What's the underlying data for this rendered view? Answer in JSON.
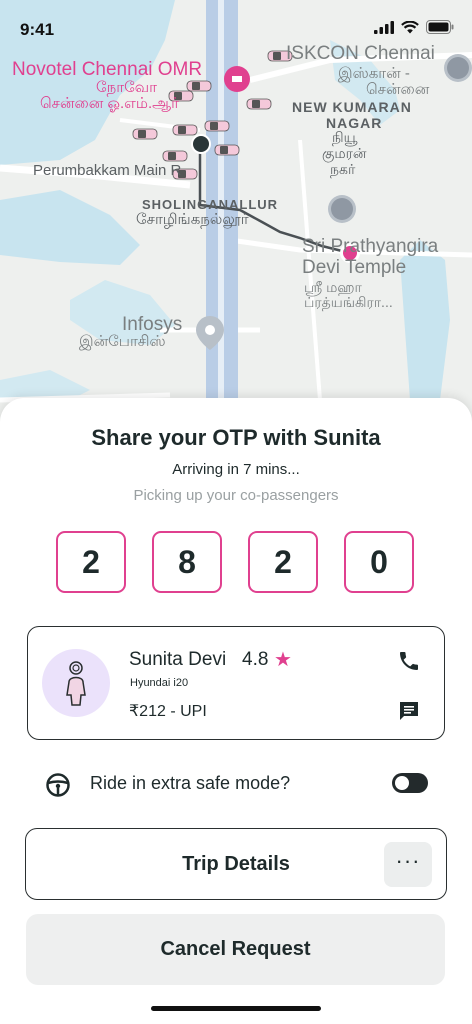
{
  "status_bar": {
    "time": "9:41"
  },
  "map": {
    "labels": {
      "novotel": "Novotel Chennai OMR",
      "novotel_tamil_1": "நோவோ",
      "novotel_tamil_2": "சென்னை ஓ.எம்.ஆர்",
      "iskcon": "ISKCON Chennai",
      "iskcon_tamil_1": "இஸ்கான் -",
      "iskcon_tamil_2": "சென்னை",
      "new_kumaran": "NEW KUMARAN",
      "nagar": "NAGAR",
      "kumaran_tamil_1": "நியூ",
      "kumaran_tamil_2": "குமரன்",
      "kumaran_tamil_3": "நகர்",
      "perumbakkam": "Perumbakkam Main R",
      "sholinganallur": "SHOLINGANALLUR",
      "sholinganallur_tamil": "சோழிங்கநல்லூர்",
      "temple_1": "Sri Prathyangira",
      "temple_2": "Devi Temple",
      "temple_tamil_1": "ஸ்ரீ மஹா",
      "temple_tamil_2": "ப்ரத்யங்கிரா...",
      "infosys": "Infosys",
      "infosys_tamil": "இன்போசிஸ்"
    },
    "colors": {
      "route": "#4a5054",
      "destination": "#e0408f",
      "pickup": "#2a3638"
    }
  },
  "sheet": {
    "title": "Share your OTP with Sunita",
    "arriving": "Arriving in 7 mins...",
    "status": "Picking up your co-passengers",
    "otp": [
      "2",
      "8",
      "2",
      "0"
    ],
    "driver": {
      "name": "Sunita Devi",
      "rating": "4.8",
      "rating_icon": "star-icon",
      "vehicle": "Hyundai i20",
      "fare": "₹212 - UPI"
    },
    "safe_mode": {
      "label": "Ride in extra safe mode?",
      "enabled": false
    },
    "trip_details_label": "Trip Details",
    "more_label": "···",
    "cancel_label": "Cancel Request"
  },
  "accent_color": "#e0408f"
}
